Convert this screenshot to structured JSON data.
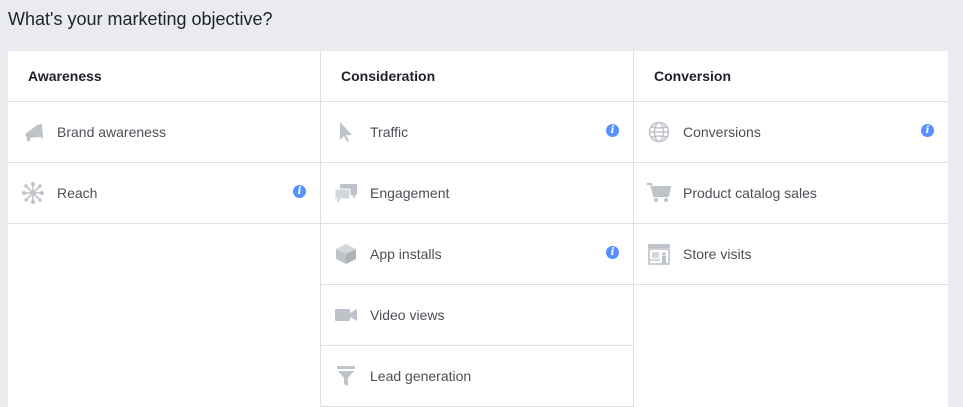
{
  "page": {
    "title": "What's your marketing objective?"
  },
  "columns": [
    {
      "header": "Awareness",
      "items": [
        {
          "label": "Brand awareness",
          "icon": "megaphone-icon",
          "info": false
        },
        {
          "label": "Reach",
          "icon": "reach-icon",
          "info": true
        }
      ]
    },
    {
      "header": "Consideration",
      "items": [
        {
          "label": "Traffic",
          "icon": "cursor-icon",
          "info": true
        },
        {
          "label": "Engagement",
          "icon": "chat-bubbles-icon",
          "info": false
        },
        {
          "label": "App installs",
          "icon": "box-icon",
          "info": true
        },
        {
          "label": "Video views",
          "icon": "video-camera-icon",
          "info": false
        },
        {
          "label": "Lead generation",
          "icon": "funnel-icon",
          "info": false
        }
      ]
    },
    {
      "header": "Conversion",
      "items": [
        {
          "label": "Conversions",
          "icon": "globe-icon",
          "info": true
        },
        {
          "label": "Product catalog sales",
          "icon": "shopping-cart-icon",
          "info": false
        },
        {
          "label": "Store visits",
          "icon": "storefront-icon",
          "info": false
        }
      ]
    }
  ],
  "info_glyph": "i",
  "colors": {
    "background": "#e9ebee",
    "panel": "#ffffff",
    "divider": "#dddfe2",
    "icon": "#bec3c9",
    "info": "#5890ff",
    "label": "#4b4f56"
  }
}
